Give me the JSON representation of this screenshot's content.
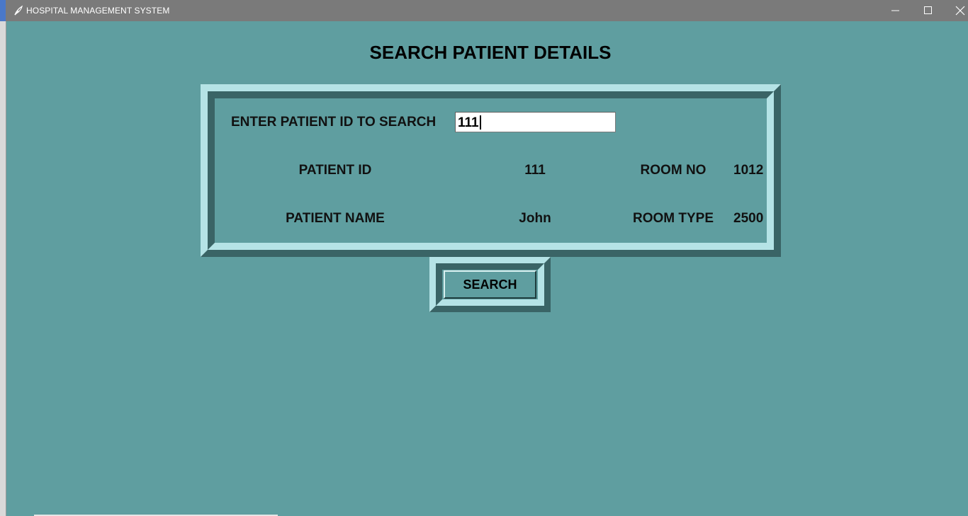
{
  "window": {
    "title": "HOSPITAL MANAGEMENT SYSTEM",
    "icon": "feather-icon",
    "controls": [
      "minimize-icon",
      "maximize-icon",
      "close-icon"
    ]
  },
  "page": {
    "heading": "SEARCH PATIENT DETAILS"
  },
  "search": {
    "prompt_label": "ENTER PATIENT ID TO SEARCH",
    "input_value": "111"
  },
  "details": {
    "patient_id_label": "PATIENT ID",
    "patient_id_value": "111",
    "patient_name_label": "PATIENT NAME",
    "patient_name_value": "John",
    "room_no_label": "ROOM NO",
    "room_no_value": "1012",
    "room_type_label": "ROOM TYPE",
    "room_type_value": "2500"
  },
  "actions": {
    "search_label": "SEARCH"
  },
  "colors": {
    "background": "#5f9ea0",
    "frame_light": "#b5e3e6",
    "frame_dark": "#3a6466",
    "titlebar": "#7a7a7a"
  }
}
